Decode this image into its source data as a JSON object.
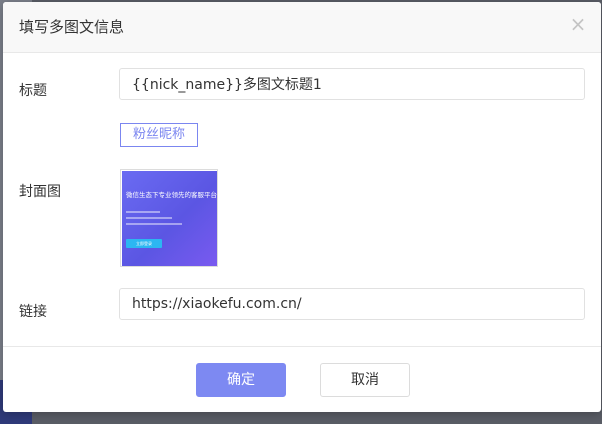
{
  "dialog": {
    "title": "填写多图文信息",
    "close_icon": "close-icon",
    "close_glyph": "×"
  },
  "form": {
    "title_label": "标题",
    "title_value": "{{nick_name}}多图文标题1",
    "insert_tag_label": "粉丝昵称",
    "cover_label": "封面图",
    "cover_thumbnail": {
      "headline": "微信生态下专业领先的客服平台",
      "button_text": "立即登录"
    },
    "link_label": "链接",
    "link_value": "https://xiaokefu.com.cn/"
  },
  "footer": {
    "confirm_label": "确定",
    "cancel_label": "取消"
  },
  "colors": {
    "accent": "#7d89f2",
    "tag_border": "#7b86f0",
    "header_bg": "#f8f8f8"
  }
}
